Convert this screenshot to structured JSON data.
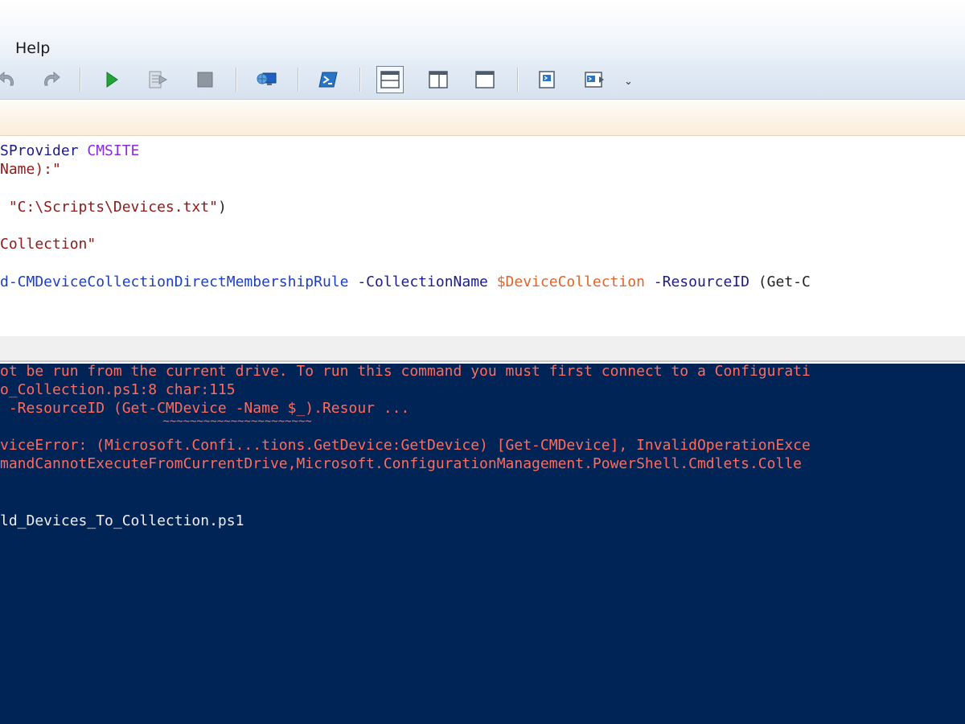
{
  "menu": {
    "help": "Help"
  },
  "toolbar": {
    "buttons": [
      {
        "name": "undo-button",
        "icon": "undo-icon"
      },
      {
        "name": "redo-button",
        "icon": "redo-icon"
      },
      {
        "name": "run-script-button",
        "icon": "run-icon"
      },
      {
        "name": "run-selection-button",
        "icon": "run-selection-icon"
      },
      {
        "name": "stop-button",
        "icon": "stop-icon"
      },
      {
        "name": "remote-powershell-button",
        "icon": "remote-icon"
      },
      {
        "name": "powershell-console-button",
        "icon": "powershell-icon"
      },
      {
        "name": "show-script-top-button",
        "icon": "layout-top-icon"
      },
      {
        "name": "show-script-right-button",
        "icon": "layout-right-icon"
      },
      {
        "name": "show-script-maximized-button",
        "icon": "layout-max-icon"
      },
      {
        "name": "show-commands-button",
        "icon": "commands-icon"
      },
      {
        "name": "show-addon-button",
        "icon": "addon-icon"
      }
    ],
    "overflow": "⌄"
  },
  "editor": {
    "line1": {
      "a": "SProvider ",
      "b": "CMSITE"
    },
    "line2": {
      "a": "Name):\""
    },
    "line3": {
      "a": " \"C:\\Scripts\\Devices.txt\"",
      "b": ")"
    },
    "line4": {
      "a": "Collection\""
    },
    "line5": {
      "a": "d-CMDeviceCollectionDirectMembershipRule",
      "b": " -CollectionName",
      "c": " $DeviceCollection",
      "d": " -ResourceID",
      "e": " (Get-C"
    }
  },
  "console": {
    "lines": [
      "ot be run from the current drive. To run this command you must first connect to a Configurati",
      "o_Collection.ps1:8 char:115",
      " -ResourceID (Get-CMDevice -Name $_).Resour ...",
      "                        ~~~~~~~~~~~~~~~~~~~~~~",
      "viceError: (Microsoft.Confi...tions.GetDevice:GetDevice) [Get-CMDevice], InvalidOperationExce",
      "mandCannotExecuteFromCurrentDrive,Microsoft.ConfigurationManagement.PowerShell.Cmdlets.Colle",
      "ld_Devices_To_Collection.ps1"
    ]
  },
  "colors": {
    "console_bg": "#012456",
    "console_error": "#ff6b5c",
    "console_text": "#eeedf0",
    "cmdlet": "#1a3fc4",
    "variable": "#e0642a",
    "string": "#8b1a1a"
  }
}
